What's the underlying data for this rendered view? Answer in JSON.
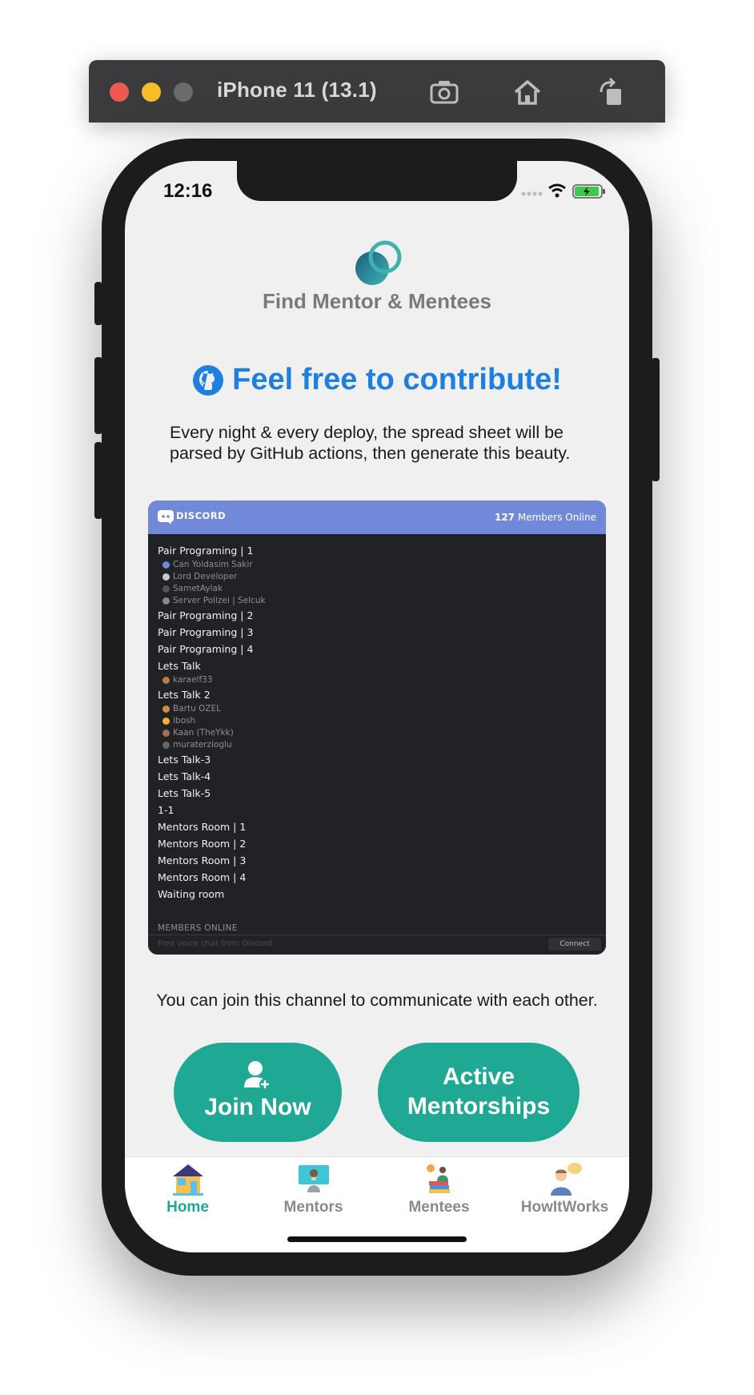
{
  "simulator": {
    "title": "iPhone 11 (13.1)",
    "buttons": [
      "screenshot-icon",
      "home-icon",
      "rotate-icon"
    ]
  },
  "status_bar": {
    "time": "12:16"
  },
  "header": {
    "app_name": "Find Mentor & Mentees"
  },
  "contribute": {
    "title": "Feel free to contribute!",
    "description": "Every night & every deploy, the spread sheet will be parsed by GitHub actions, then generate this beauty."
  },
  "discord": {
    "brand": "DISCORD",
    "online_count": "127",
    "online_label": "Members Online",
    "channels": [
      {
        "name": "Pair Programing | 1",
        "members": [
          "Can Yoldasim Sakir",
          "Lord Developer",
          "SametAylak",
          "Server Polizei | Selcuk"
        ]
      },
      {
        "name": "Pair Programing | 2",
        "members": []
      },
      {
        "name": "Pair Programing | 3",
        "members": []
      },
      {
        "name": "Pair Programing | 4",
        "members": []
      },
      {
        "name": "Lets Talk",
        "members": [
          "karaelf33"
        ]
      },
      {
        "name": "Lets Talk 2",
        "members": [
          "Bartu OZEL",
          "ibosh",
          "Kaan (TheYkk)",
          "muraterzioglu"
        ]
      },
      {
        "name": "Lets Talk-3",
        "members": []
      },
      {
        "name": "Lets Talk-4",
        "members": []
      },
      {
        "name": "Lets Talk-5",
        "members": []
      },
      {
        "name": "1-1",
        "members": []
      },
      {
        "name": "Mentors Room | 1",
        "members": []
      },
      {
        "name": "Mentors Room | 2",
        "members": []
      },
      {
        "name": "Mentors Room | 3",
        "members": []
      },
      {
        "name": "Mentors Room | 4",
        "members": []
      },
      {
        "name": "Waiting room",
        "members": []
      }
    ],
    "members_online_heading": "MEMBERS ONLINE",
    "footer_text": "Free voice chat from Discord",
    "connect_label": "Connect"
  },
  "join_text": "You can join this channel to communicate with each other.",
  "buttons": {
    "join_now": "Join Now",
    "active_line1": "Active",
    "active_line2": "Mentorships"
  },
  "tabs": [
    {
      "label": "Home",
      "icon": "home-icon",
      "active": true
    },
    {
      "label": "Mentors",
      "icon": "mentor-icon",
      "active": false
    },
    {
      "label": "Mentees",
      "icon": "mentee-icon",
      "active": false
    },
    {
      "label": "HowItWorks",
      "icon": "how-it-works-icon",
      "active": false
    }
  ],
  "colors": {
    "accent": "#1fa994",
    "link_blue": "#1f7fe0",
    "discord_blurple": "#7289da"
  }
}
